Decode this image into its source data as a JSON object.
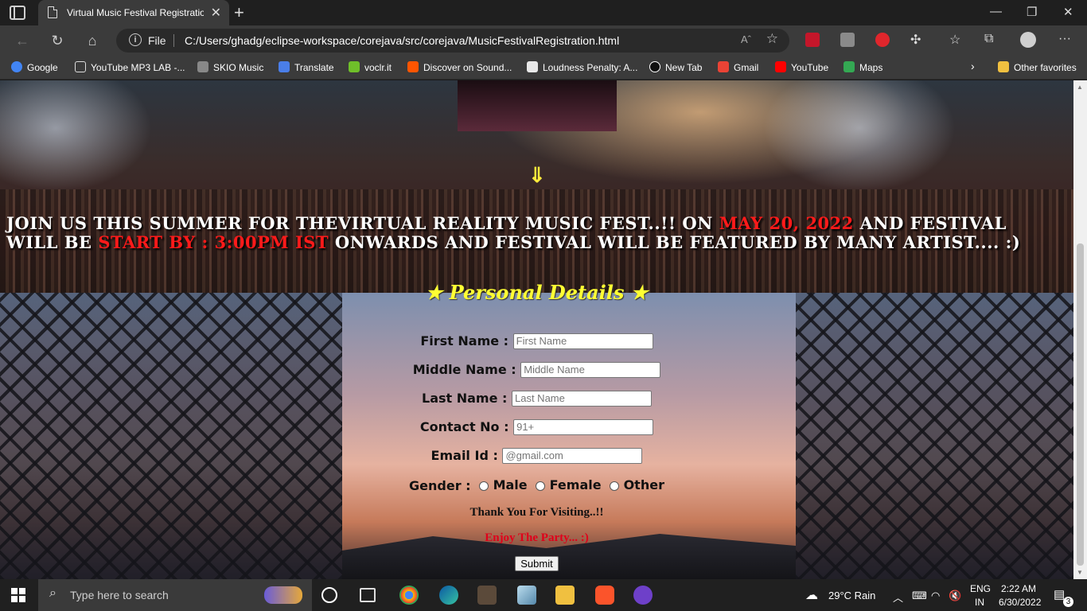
{
  "browser": {
    "tab_title": "Virtual Music Festival Registration",
    "file_label": "File",
    "url": "C:/Users/ghadg/eclipse-workspace/corejava/src/corejava/MusicFestivalRegistration.html",
    "read_aloud": "Aˆ"
  },
  "bookmarks": [
    {
      "label": "Google",
      "color": "#4285f4"
    },
    {
      "label": "YouTube MP3 LAB -...",
      "color": "#dddddd"
    },
    {
      "label": "SKIO Music",
      "color": "#888888"
    },
    {
      "label": "Translate",
      "color": "#4a7ee8"
    },
    {
      "label": "voclr.it",
      "color": "#6fbf2a"
    },
    {
      "label": "Discover on Sound...",
      "color": "#ff5500"
    },
    {
      "label": "Loudness Penalty: A...",
      "color": "#e8e8e8"
    },
    {
      "label": "New Tab",
      "color": "#111111"
    },
    {
      "label": "Gmail",
      "color": "#ea4335"
    },
    {
      "label": "YouTube",
      "color": "#ff0000"
    },
    {
      "label": "Maps",
      "color": "#34a853"
    }
  ],
  "other_favorites": "Other favorites",
  "page": {
    "arrow": "⇓",
    "announce_part1": "Join us this summer for theVirtual Reality Music Fest..!! On ",
    "announce_date": "May 20, 2022",
    "announce_part2": " and Festival will be ",
    "announce_start": "start By : 3:00PM IST",
    "announce_part3": " onwards and festival will be featured by many artist.... :)",
    "section_title": "★ Personal Details ★",
    "form": {
      "first_label": "First Name :",
      "first_ph": "First Name",
      "middle_label": "Middle Name :",
      "middle_ph": "Middle Name",
      "last_label": "Last Name :",
      "last_ph": "Last Name",
      "contact_label": "Contact No :",
      "contact_ph": "91+",
      "email_label": "Email Id :",
      "email_ph": "@gmail.com",
      "gender_label": "Gender :",
      "male": "Male",
      "female": "Female",
      "other": "Other"
    },
    "thanks": "Thank You For Visiting..!!",
    "party": "Enjoy The Party... :)",
    "submit": "Submit"
  },
  "taskbar": {
    "search_placeholder": "Type here to search",
    "weather": "29°C  Rain",
    "lang1": "ENG",
    "lang2": "IN",
    "time": "2:22 AM",
    "date": "6/30/2022",
    "notif": "3"
  }
}
